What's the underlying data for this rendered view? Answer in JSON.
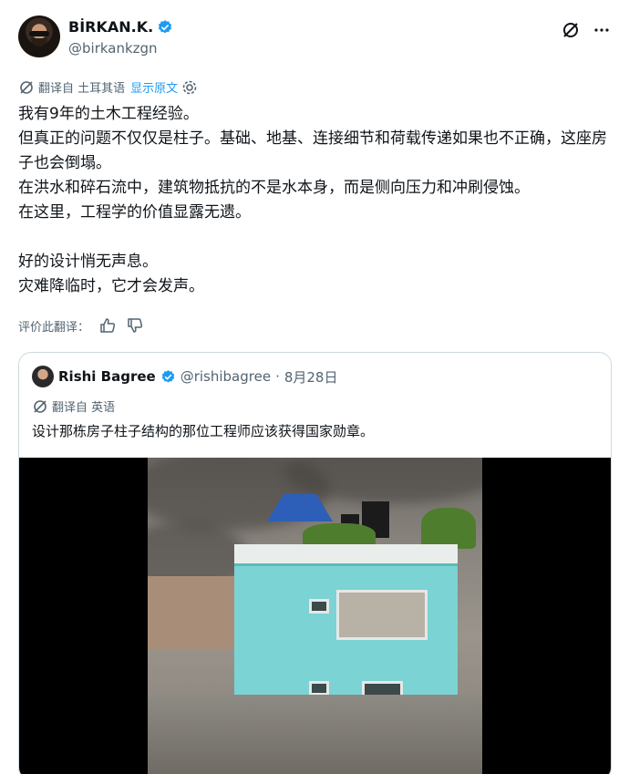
{
  "author": {
    "display_name": "BİRKAN.K.",
    "handle": "@birkankzgn"
  },
  "translation": {
    "label": "翻译自 土耳其语",
    "show_original": "显示原文"
  },
  "post": {
    "lines": [
      "我有9年的土木工程经验。",
      "但真正的问题不仅仅是柱子。基础、地基、连接细节和荷载传递如果也不正确，这座房子也会倒塌。",
      "在洪水和碎石流中，建筑物抵抗的不是水本身，而是侧向压力和冲刷侵蚀。",
      "在这里，工程学的价值显露无遗。",
      "",
      "好的设计悄无声息。",
      "灾难降临时，它才会发声。"
    ]
  },
  "rate": {
    "label": "评价此翻译："
  },
  "quoted": {
    "display_name": "Rishi Bagree",
    "handle": "@rishibagree",
    "separator": "·",
    "date": "8月28日",
    "translation_label": "翻译自 英语",
    "text": "设计那栋房子柱子结构的那位工程师应该获得国家勋章。"
  },
  "colors": {
    "accent": "#1d9bf0",
    "secondary_text": "#536471",
    "border": "#cfd9de"
  }
}
